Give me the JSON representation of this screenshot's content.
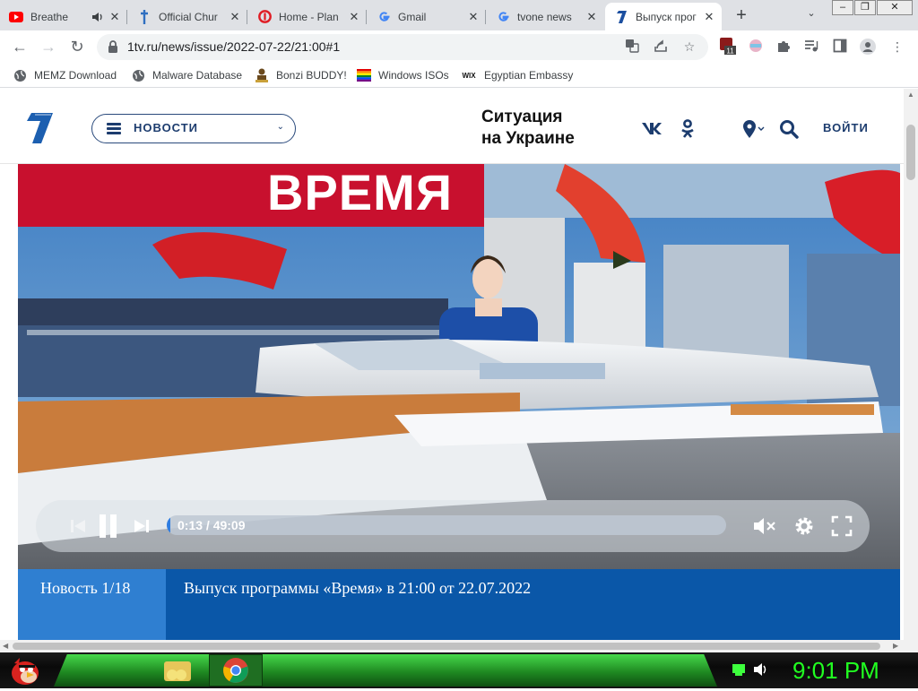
{
  "browser": {
    "tabs": [
      {
        "title": "Breathe",
        "icon": "youtube-icon",
        "active": false
      },
      {
        "title": "Official Chur",
        "icon": "church-icon",
        "active": false
      },
      {
        "title": "Home - Plan",
        "icon": "opera-icon",
        "active": false
      },
      {
        "title": "Gmail",
        "icon": "google-icon",
        "active": false
      },
      {
        "title": "tvone news",
        "icon": "google-icon",
        "active": false
      },
      {
        "title": "Выпуск прог",
        "icon": "channel-one-icon",
        "active": true
      }
    ],
    "url": "1tv.ru/news/issue/2022-07-22/21:00#1",
    "extension_badge": "11",
    "bookmarks": [
      {
        "label": "MEMZ Download",
        "icon": "globe-icon"
      },
      {
        "label": "Malware Database",
        "icon": "globe-icon"
      },
      {
        "label": "Bonzi BUDDY!",
        "icon": "bonzi-icon"
      },
      {
        "label": "Windows ISOs",
        "icon": "rainbow-flag-icon"
      },
      {
        "label": "Egyptian Embassy",
        "icon": "wix-icon"
      }
    ],
    "wix_glyph": "WIX"
  },
  "site": {
    "menu_label": "НОВОСТИ",
    "situation_line1": "Ситуация",
    "situation_line2": "на Украине",
    "login_label": "ВОЙТИ",
    "brand_color": "#1c3c6e"
  },
  "video": {
    "current_time": "0:13",
    "duration": "49:09",
    "time_display": "0:13 / 49:09",
    "progress": 0.0044,
    "studio_sign": "ВРЕМЯ"
  },
  "caption": {
    "index": "Новость 1/18",
    "text": "Выпуск программы «Время» в 21:00 от 22.07.2022"
  },
  "taskbar": {
    "clock": "9:01 PM"
  },
  "colors": {
    "caption_bg": "#0a57a8",
    "caption_index_bg": "#2f7fd1",
    "progress_fill": "#2f7de1",
    "clock_green": "#21ff21"
  }
}
